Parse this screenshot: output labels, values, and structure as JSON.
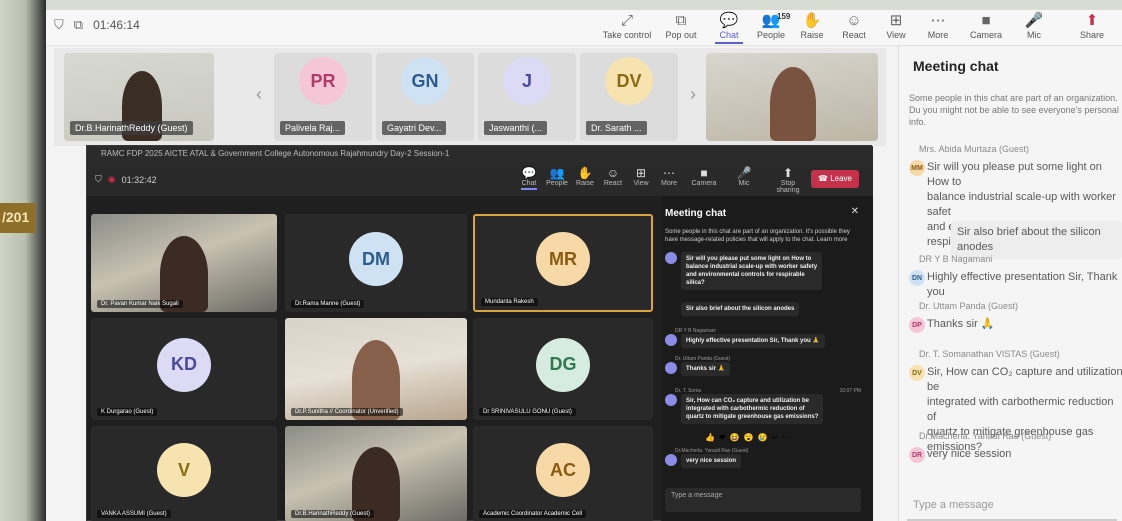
{
  "outer": {
    "timer": "01:46:14",
    "toolbar": [
      {
        "icon": "take-control-icon",
        "glyph": "⤢",
        "label": "Take control"
      },
      {
        "icon": "pop-out-icon",
        "glyph": "⧉",
        "label": "Pop out"
      },
      {
        "icon": "chat-icon",
        "glyph": "💬",
        "label": "Chat"
      },
      {
        "icon": "people-icon",
        "glyph": "👥",
        "label": "People",
        "badge": "159"
      },
      {
        "icon": "raise-hand-icon",
        "glyph": "✋",
        "label": "Raise"
      },
      {
        "icon": "react-icon",
        "glyph": "☺",
        "label": "React"
      },
      {
        "icon": "view-icon",
        "glyph": "⊞",
        "label": "View"
      },
      {
        "icon": "more-icon",
        "glyph": "⋯",
        "label": "More"
      },
      {
        "icon": "camera-icon",
        "glyph": "■",
        "label": "Camera"
      },
      {
        "icon": "mic-icon",
        "glyph": "🎤",
        "label": "Mic"
      },
      {
        "icon": "share-icon",
        "glyph": "⬆",
        "label": "Share"
      }
    ],
    "strip": [
      {
        "name": "Dr.B.HarinathReddy (Guest)",
        "kind": "photo"
      },
      {
        "initials": "PR",
        "name": "Palivela Raj...",
        "color": "#f4c6d6",
        "text_color": "#b03a68"
      },
      {
        "initials": "GN",
        "name": "Gayatri Dev...",
        "color": "#cfe2f3",
        "text_color": "#2c5c8f"
      },
      {
        "initials": "J",
        "name": "Jaswanthi (...",
        "color": "#dcdaf5",
        "text_color": "#4b4a9c"
      },
      {
        "initials": "DV",
        "name": "Dr. Sarath ...",
        "color": "#f7e3b0",
        "text_color": "#8a6a12"
      },
      {
        "name": "",
        "kind": "photo2"
      }
    ],
    "chat": {
      "title": "Meeting chat",
      "note": "Some people in this chat are part of an organization. Du you might not be able to see everyone's personal info.",
      "messages": [
        {
          "sender": "Mrs. Abida Murtaza (Guest)",
          "initials": "MM",
          "av_color": "#f7d9a8",
          "av_text": "#8a5a12",
          "lines": [
            "Sir will you please put some light on How to",
            "balance industrial scale-up with worker safet",
            "and environmental controls for respirable sili"
          ]
        },
        {
          "sender": "",
          "initials": "",
          "lines": [
            "Sir also brief about the silicon anodes"
          ]
        },
        {
          "sender": "DR Y B Nagamani",
          "initials": "DN",
          "av_color": "#cfe2f3",
          "av_text": "#2c5c8f",
          "lines": [
            "Highly effective presentation Sir, Thank you"
          ]
        },
        {
          "sender": "Dr. Uttam Panda (Guest)",
          "initials": "DP",
          "av_color": "#f4c6d6",
          "av_text": "#b03a68",
          "lines": [
            "Thanks sir 🙏"
          ]
        },
        {
          "sender": "Dr. T. Somanathan VISTAS (Guest)",
          "initials": "DV",
          "av_color": "#f7e3b0",
          "av_text": "#8a6a12",
          "lines": [
            "Sir, How can CO₂ capture and utilization be",
            "integrated with carbothermic reduction of",
            "quartz to mitigate greenhouse gas emissions?"
          ]
        },
        {
          "sender": "Dr.Macherla. Yanadi Rao (Guest)",
          "initials": "DR",
          "av_color": "#f4c6d6",
          "av_text": "#b03a68",
          "lines": [
            "very nice session"
          ]
        }
      ],
      "compose_placeholder": "Type a message"
    }
  },
  "inner": {
    "window_title": "RAMC FDP 2025 AICTE ATAL & Government College Autonomous Rajahmundry Day-2 Session-1",
    "timer": "01:32:42",
    "toolbar": [
      {
        "icon": "chat-icon",
        "glyph": "💬",
        "label": "Chat"
      },
      {
        "icon": "people-icon",
        "glyph": "👥",
        "label": "People"
      },
      {
        "icon": "raise-hand-icon",
        "glyph": "✋",
        "label": "Raise"
      },
      {
        "icon": "react-icon",
        "glyph": "☺",
        "label": "React"
      },
      {
        "icon": "view-icon",
        "glyph": "⊞",
        "label": "View"
      },
      {
        "icon": "more-icon",
        "glyph": "⋯",
        "label": "More"
      },
      {
        "icon": "camera-icon",
        "glyph": "■",
        "label": "Camera"
      },
      {
        "icon": "mic-icon",
        "glyph": "🎤",
        "label": "Mic"
      },
      {
        "icon": "share-icon",
        "glyph": "⬆",
        "label": "Stop sharing"
      }
    ],
    "leave_label": "Leave",
    "tiles": [
      {
        "name": "Dr. Pavan Kumar Naik Sugali",
        "kind": "photo"
      },
      {
        "initials": "DM",
        "name": "Dr.Rama Manne (Guest)",
        "color": "#cfe2f3",
        "text_color": "#2c5c8f"
      },
      {
        "initials": "MR",
        "name": "Mundanta Rakesh",
        "color": "#f7d9a8",
        "text_color": "#8a5a12",
        "selected": true
      },
      {
        "initials": "KD",
        "name": "K Durgarao (Guest)",
        "color": "#dcdaf5",
        "text_color": "#4b4a9c"
      },
      {
        "name": "Dr.P.Sunitha // Coordinator (Unverified)",
        "kind": "photo2"
      },
      {
        "initials": "DG",
        "name": "Dr SRINIVASULU GONU (Guest)",
        "color": "#d6ece1",
        "text_color": "#2f7a52"
      },
      {
        "initials": "V",
        "name": "VANKA ASSUMI (Guest)",
        "color": "#f7e3b0",
        "text_color": "#8a6a12"
      },
      {
        "name": "Dr.B.HarinathReddy (Guest)",
        "kind": "photo"
      },
      {
        "initials": "AC",
        "name": "Academic Coordinator Academic Cell",
        "color": "#f7d9a8",
        "text_color": "#8a5a12"
      }
    ],
    "chat": {
      "title": "Meeting chat",
      "note": "Some people in this chat are part of an organization. It's possible they have message-related policies that will apply to the chat. Learn more",
      "messages": [
        {
          "sender": "",
          "lines": [
            "Sir will you please put some light on How to",
            "balance industrial scale-up with worker safety",
            "and environmental controls for respirable",
            "silica?"
          ]
        },
        {
          "sender": "",
          "lines": [
            "Sir also brief about the silicon anodes"
          ]
        },
        {
          "sender": "DR Y B Nagamani",
          "lines": [
            "Highly effective presentation Sir, Thank you 🙏"
          ]
        },
        {
          "sender": "Dr. Uttam Panda (Guest)",
          "lines": [
            "Thanks sir 🙏"
          ]
        },
        {
          "sender": "Dr. T. Soma",
          "time": "10:07 PM",
          "lines": [
            "Sir, How can CO₂ capture and utilization be",
            "integrated with carbothermic reduction of",
            "quartz to mitigate greenhouse gas emissions?"
          ]
        },
        {
          "sender": "Dr.Macherla. Yanadi Rao (Guest)",
          "lines": [
            "very nice session"
          ]
        }
      ],
      "reactions": [
        "👍",
        "❤",
        "😆",
        "😮",
        "😢",
        "↩",
        "⋯"
      ],
      "compose_placeholder": "Type a message"
    }
  }
}
